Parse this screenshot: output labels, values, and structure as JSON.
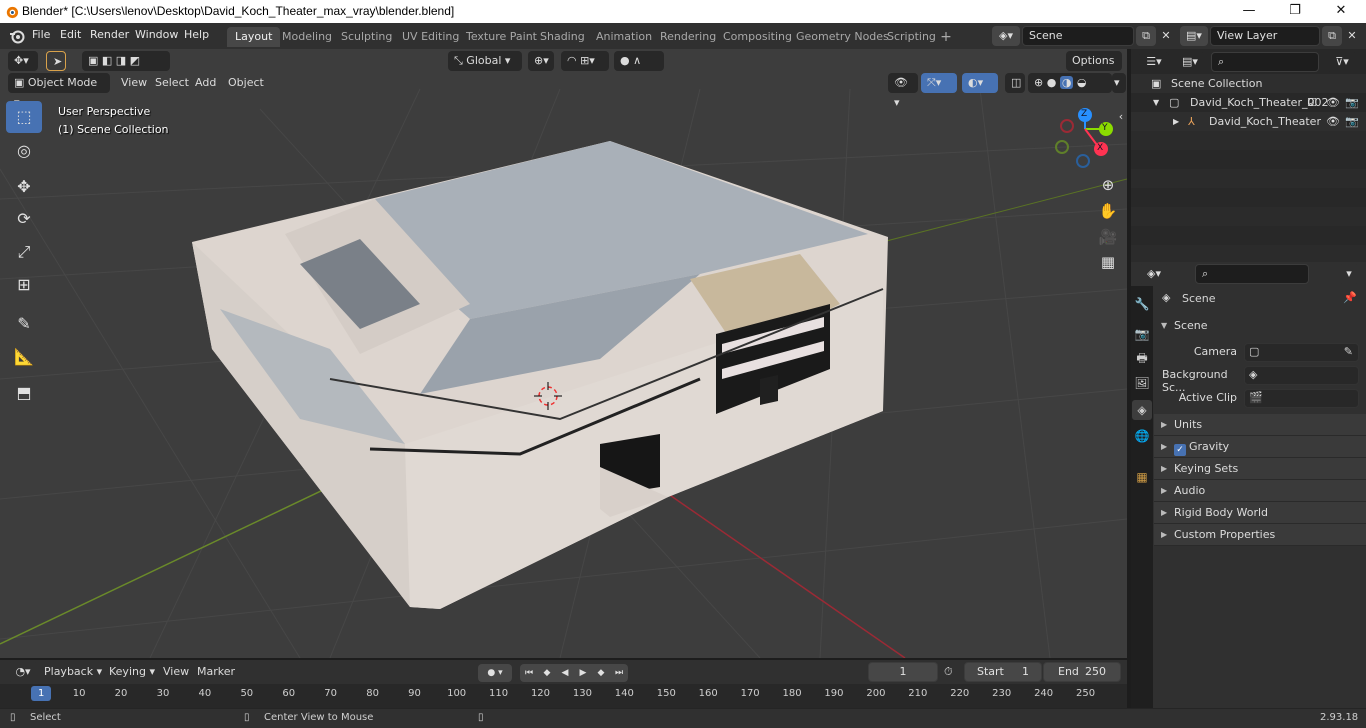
{
  "window": {
    "title": "Blender* [C:\\Users\\lenov\\Desktop\\David_Koch_Theater_max_vray\\blender.blend]",
    "minimize_glyph": "—",
    "maximize_glyph": "❐",
    "close_glyph": "✕"
  },
  "menu": {
    "items": [
      "File",
      "Edit",
      "Render",
      "Window",
      "Help"
    ]
  },
  "workspaces": {
    "tabs": [
      "Layout",
      "Modeling",
      "Sculpting",
      "UV Editing",
      "Texture Paint",
      "Shading",
      "Animation",
      "Rendering",
      "Compositing",
      "Geometry Nodes",
      "Scripting"
    ],
    "active": "Layout",
    "add_glyph": "+"
  },
  "scene_selector": {
    "value": "Scene"
  },
  "view_layer_selector": {
    "value": "View Layer"
  },
  "viewport": {
    "transform_orientation": "Global",
    "options_label": "Options",
    "mode": "Object Mode",
    "menus": [
      "View",
      "Select",
      "Add",
      "Object"
    ],
    "perspective_text": "User Perspective",
    "collection_text": "(1) Scene Collection",
    "gizmo_axes": {
      "x": "X",
      "y": "Y",
      "z": "Z"
    }
  },
  "outliner": {
    "rows": [
      {
        "label": "Scene Collection"
      },
      {
        "label": "David_Koch_Theater_002"
      },
      {
        "label": "David_Koch_Theater"
      }
    ]
  },
  "properties": {
    "header": "Scene",
    "section": "Scene",
    "fields": [
      {
        "label": "Camera"
      },
      {
        "label": "Background Sc..."
      },
      {
        "label": "Active Clip"
      }
    ],
    "panels": [
      "Units",
      "Gravity",
      "Keying Sets",
      "Audio",
      "Rigid Body World",
      "Custom Properties"
    ],
    "gravity_checked": true,
    "version": "2.93.18"
  },
  "timeline": {
    "menus": [
      "Playback",
      "Keying",
      "View",
      "Marker"
    ],
    "current_frame": "1",
    "start_label": "Start",
    "start_value": "1",
    "end_label": "End",
    "end_value": "250",
    "ruler_labels": [
      "1",
      "10",
      "20",
      "30",
      "40",
      "50",
      "60",
      "70",
      "80",
      "90",
      "100",
      "110",
      "120",
      "130",
      "140",
      "150",
      "160",
      "170",
      "180",
      "190",
      "200",
      "210",
      "220",
      "230",
      "240",
      "250"
    ]
  },
  "statusbar": {
    "select": "Select",
    "center": "Center View to Mouse",
    "version": "2.93.18"
  },
  "colors": {
    "accent": "#4772b3",
    "x_axis": "#ff3352",
    "y_axis": "#8bdc00",
    "z_axis": "#2890ff",
    "viewport_bg": "#3d3d3d",
    "panel_bg": "#303030"
  }
}
